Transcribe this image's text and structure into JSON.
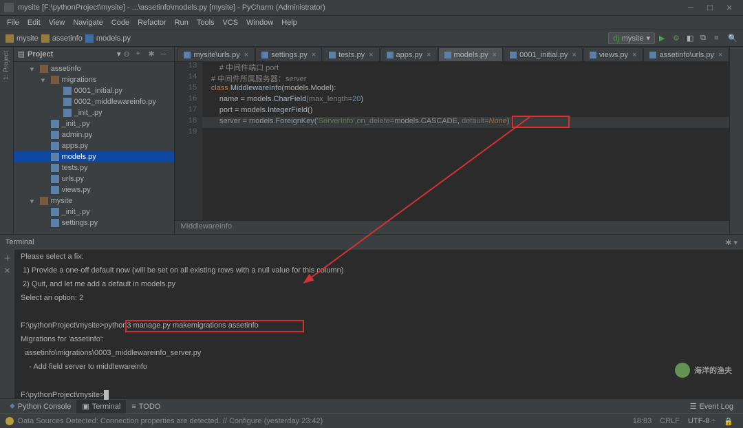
{
  "title": "mysite [F:\\pythonProject\\mysite] - ...\\assetinfo\\models.py [mysite] - PyCharm (Administrator)",
  "menu": [
    "File",
    "Edit",
    "View",
    "Navigate",
    "Code",
    "Refactor",
    "Run",
    "Tools",
    "VCS",
    "Window",
    "Help"
  ],
  "crumbs": {
    "p1": "mysite",
    "p2": "assetinfo",
    "p3": "models.py"
  },
  "runcfg": "mysite",
  "project": {
    "header": "Project",
    "assetinfo": "assetinfo",
    "migrations": "migrations",
    "file_0001": "0001_initial.py",
    "file_0002": "0002_middlewareinfo.py",
    "file_init_m": "_init_.py",
    "file_init": "_init_.py",
    "file_admin": "admin.py",
    "file_apps": "apps.py",
    "file_models": "models.py",
    "file_tests": "tests.py",
    "file_urls": "urls.py",
    "file_views": "views.py",
    "mysite": "mysite",
    "file_init2": "_init_.py",
    "file_settings": "settings.py"
  },
  "leftRail": {
    "v1": "1: Project"
  },
  "tabs": [
    {
      "label": "mysite\\urls.py"
    },
    {
      "label": "settings.py"
    },
    {
      "label": "tests.py"
    },
    {
      "label": "apps.py"
    },
    {
      "label": "models.py",
      "active": true
    },
    {
      "label": "0001_initial.py"
    },
    {
      "label": "views.py"
    },
    {
      "label": "assetinfo\\urls.py"
    }
  ],
  "code": {
    "l13": "        # 中间件端口 port",
    "l14": "    # 中间件所属服务器：server",
    "l15_a": "    class ",
    "l15_b": "MiddlewareInfo",
    "l15_c": "(models.Model):",
    "l16_a": "        name = models.",
    "l16_b": "CharField",
    "l16_c": "(max_length=",
    "l16_d": "20",
    "l16_e": ")",
    "l17_a": "        port = models.",
    "l17_b": "IntegerField",
    "l17_c": "()",
    "l18_a": "        server = models.",
    "l18_b": "ForeignKey",
    "l18_c": "(",
    "l18_d": "'ServerInfo'",
    "l18_e": ",on_delete=",
    "l18_f": "models.CASCADE, ",
    "l18_g": "default=",
    "l18_h": "None",
    "l18_i": ")",
    "breadcrumb": "MiddlewareInfo"
  },
  "gutter": [
    "13",
    "14",
    "15",
    "16",
    "17",
    "18",
    "19"
  ],
  "terminal": {
    "title": "Terminal",
    "lines": [
      "Please select a fix:",
      " 1) Provide a one-off default now (will be set on all existing rows with a null value for this column)",
      " 2) Quit, and let me add a default in models.py",
      "Select an option: 2",
      "",
      "F:\\pythonProject\\mysite>python3 manage.py makemigrations assetinfo",
      "Migrations for 'assetinfo':",
      "  assetinfo\\migrations\\0003_middlewareinfo_server.py",
      "    - Add field server to middlewareinfo",
      "",
      "F:\\pythonProject\\mysite>"
    ]
  },
  "bottom": {
    "pyconsole": "Python Console",
    "terminal": "Terminal",
    "todo": "TODO",
    "eventlog": "Event Log"
  },
  "status": {
    "msg": "Data Sources Detected: Connection properties are detected. // Configure (yesterday 23:42)",
    "pos": "18:83",
    "crlf": "CRLF",
    "enc": "UTF-8",
    "lock": ""
  },
  "watermark": "海洋的渔夫"
}
